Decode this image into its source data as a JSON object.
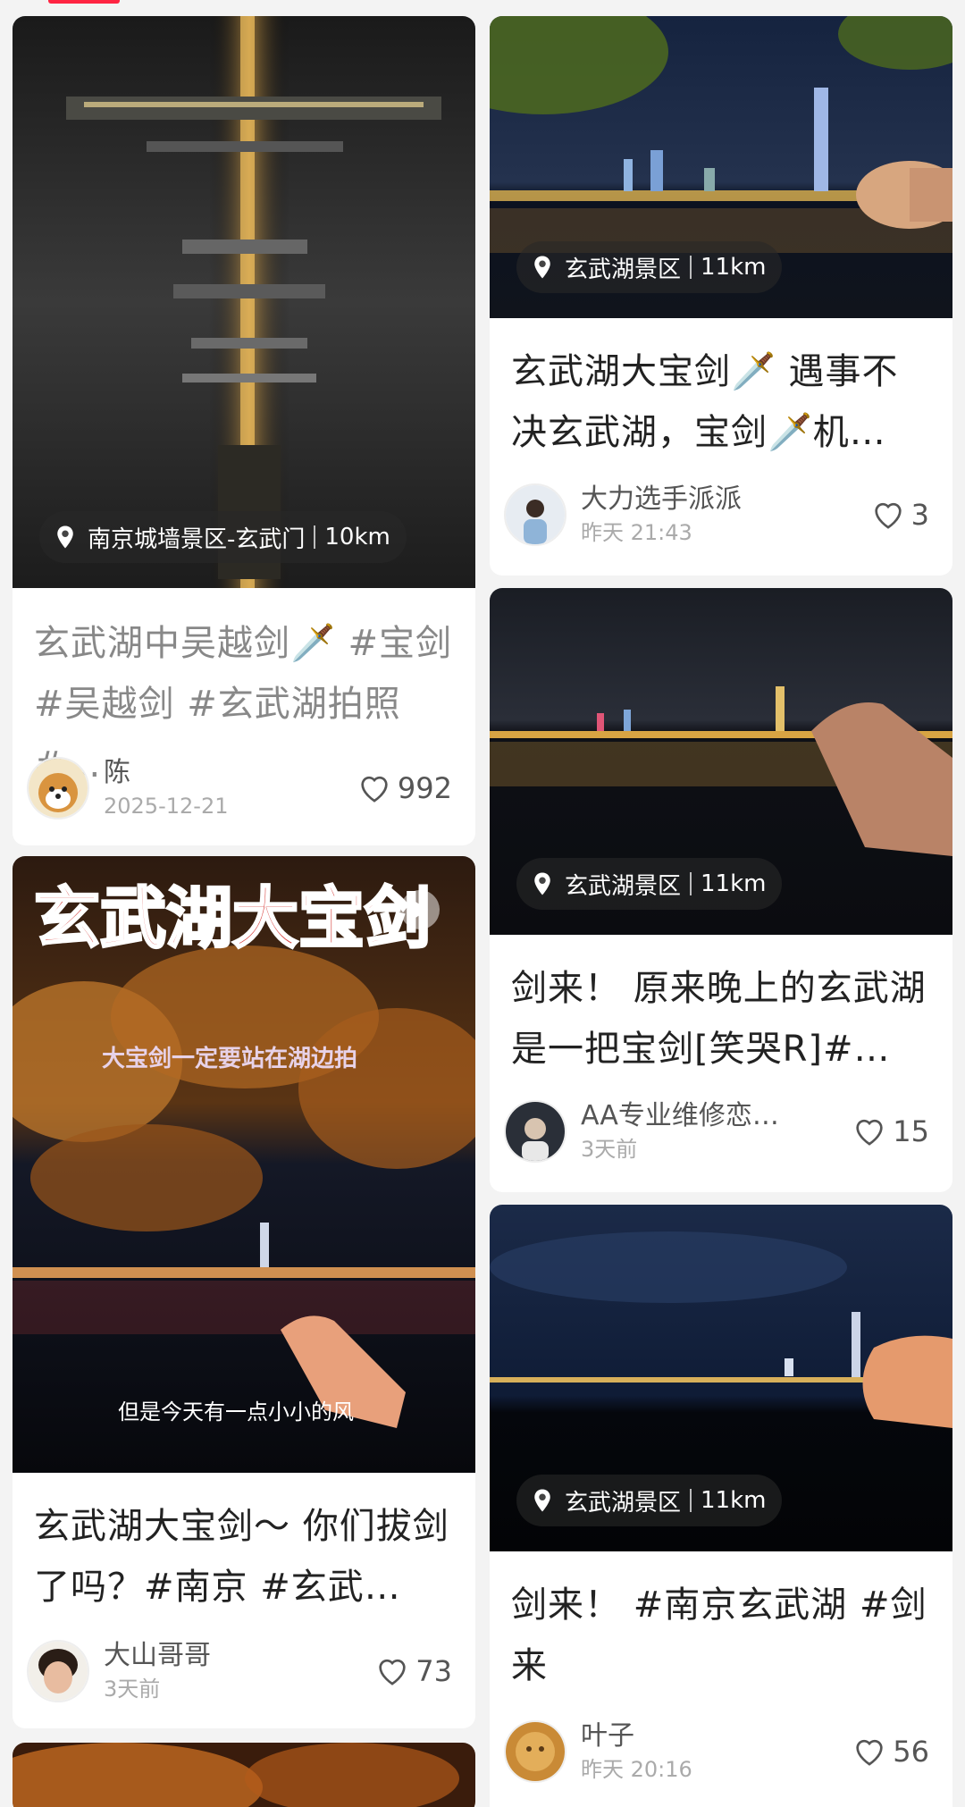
{
  "colors": {
    "brand": "#ff2442",
    "title": "#222222",
    "meta": "#aaaaaa"
  },
  "icons": {
    "location": "location-pin-icon",
    "like": "heart-outline-icon",
    "play": "play-icon"
  },
  "cards": [
    {
      "location": "南京城墙景区-玄武门",
      "distance": "10km",
      "title": "玄武湖中吴越剑🗡️ #宝剑 #吴越剑 #玄武湖拍照 #…",
      "author": "陈",
      "time": "2025-12-21",
      "likes": "992"
    },
    {
      "location": "玄武湖景区",
      "distance": "11km",
      "title": "玄武湖大宝剑🗡️ 遇事不决玄武湖，宝剑🗡️机…",
      "author": "大力选手派派",
      "time": "昨天 21:43",
      "likes": "3"
    },
    {
      "location": "玄武湖景区",
      "distance": "11km",
      "title": "剑来！ 原来晚上的玄武湖是一把宝剑[笑哭R]#…",
      "author": "AA专业维修恋…",
      "time": "3天前",
      "likes": "15"
    },
    {
      "cover_text": "玄武湖大宝剑",
      "cover_sub": "大宝剑一定要站在湖边拍",
      "cover_caption": "但是今天有一点小小的风",
      "title": "玄武湖大宝剑～ 你们拔剑了吗？#南京 #玄武…",
      "author": "大山哥哥",
      "time": "3天前",
      "likes": "73"
    },
    {
      "location": "玄武湖景区",
      "distance": "11km",
      "title": "剑来！ #南京玄武湖 #剑来",
      "author": "叶子",
      "time": "昨天 20:16",
      "likes": "56"
    }
  ]
}
